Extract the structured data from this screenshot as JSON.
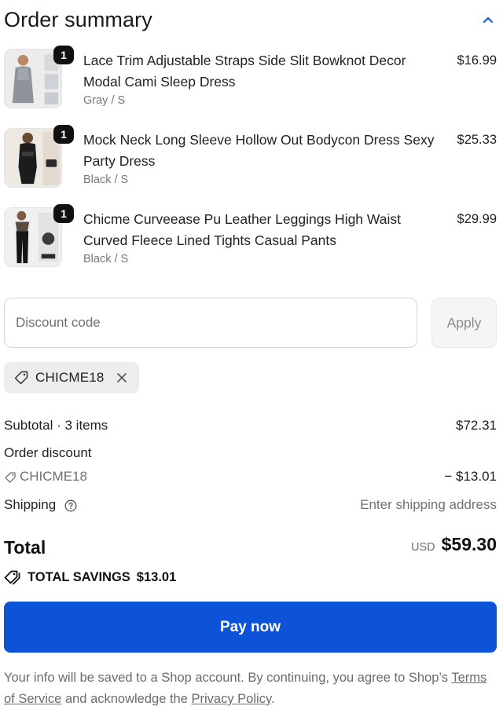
{
  "header": {
    "title": "Order summary"
  },
  "items": [
    {
      "quantity": "1",
      "title": "Lace Trim Adjustable Straps Side Slit Bowknot Decor Modal Cami Sleep Dress",
      "variant": "Gray / S",
      "price": "$16.99"
    },
    {
      "quantity": "1",
      "title": "Mock Neck Long Sleeve Hollow Out Bodycon Dress Sexy Party Dress",
      "variant": "Black / S",
      "price": "$25.33"
    },
    {
      "quantity": "1",
      "title": "Chicme Curveease Pu Leather Leggings High Waist Curved Fleece Lined Tights Casual Pants",
      "variant": "Black / S",
      "price": "$29.99"
    }
  ],
  "discount": {
    "placeholder": "Discount code",
    "apply_label": "Apply",
    "applied_code": "CHICME18"
  },
  "summary": {
    "subtotal_label": "Subtotal · 3 items",
    "subtotal_value": "$72.31",
    "order_discount_label": "Order discount",
    "discount_code": "CHICME18",
    "discount_value": "− $13.01",
    "shipping_label": "Shipping",
    "shipping_value": "Enter shipping address",
    "total_label": "Total",
    "currency": "USD",
    "total_value": "$59.30",
    "savings_label": "TOTAL SAVINGS",
    "savings_value": "$13.01"
  },
  "pay_button": {
    "label": "Pay now"
  },
  "footer": {
    "text_part1": "Your info will be saved to a Shop account. By continuing, you agree to Shop’s ",
    "terms_link": "Terms of Service",
    "text_part2": " and acknowledge the ",
    "privacy_link": "Privacy Policy",
    "text_part3": "."
  },
  "colors": {
    "accent": "#0c53d8",
    "muted": "#707070"
  },
  "icons": [
    "chevron-up-icon",
    "tag-icon",
    "close-icon",
    "help-circle-icon",
    "tags-icon"
  ]
}
